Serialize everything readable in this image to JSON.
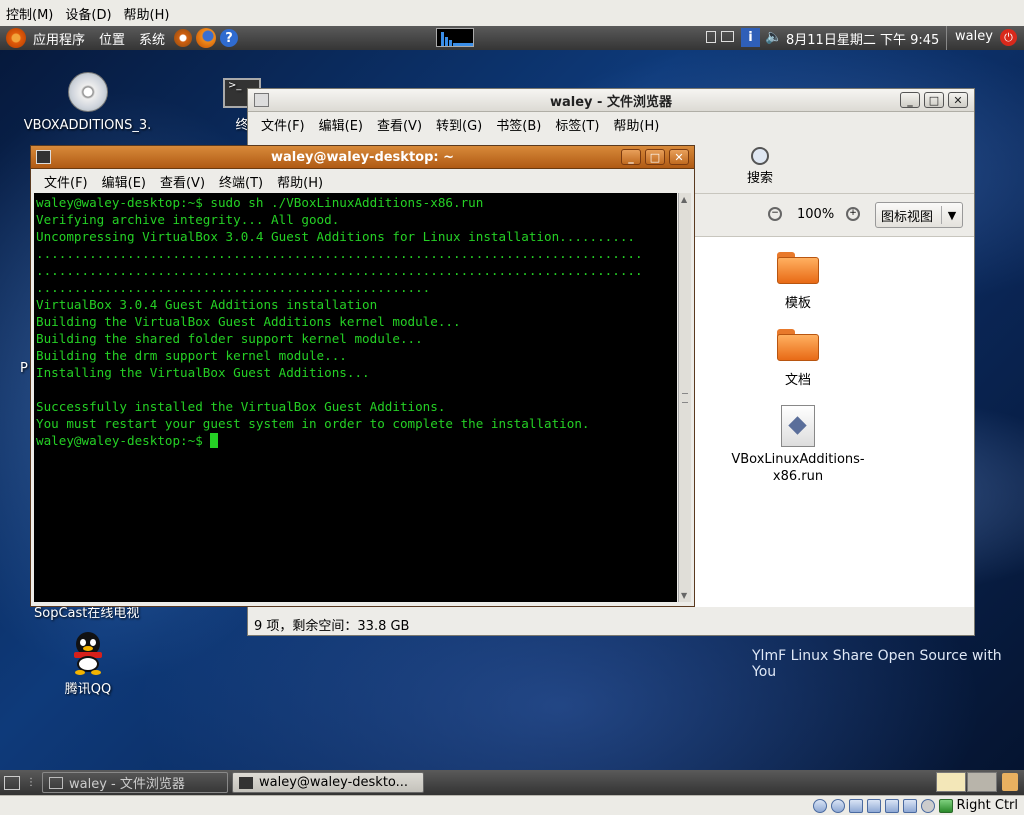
{
  "host": {
    "menu": [
      "控制(M)",
      "设备(D)",
      "帮助(H)"
    ],
    "status": {
      "hostkey": "Right Ctrl"
    }
  },
  "panel": {
    "menus": [
      "应用程序",
      "位置",
      "系统"
    ],
    "datetime": "8月11日星期二 下午 9:45",
    "user": "waley"
  },
  "desktop": {
    "icons": {
      "cd": "VBOXADDITIONS_3.",
      "terminal_partial": "终",
      "sopcast_partial": "SopCast在线电视",
      "qq": "腾讯QQ",
      "left_partial": "P"
    },
    "watermark": "YlmF Linux Share Open Source with You"
  },
  "file_browser": {
    "title": "waley - 文件浏览器",
    "menu": [
      "文件(F)",
      "编辑(E)",
      "查看(V)",
      "转到(G)",
      "书签(B)",
      "标签(T)",
      "帮助(H)"
    ],
    "search_label": "搜索",
    "zoom": "100%",
    "view_mode": "图标视图",
    "files": [
      {
        "name": "模板",
        "type": "folder"
      },
      {
        "name": "文档",
        "type": "folder"
      },
      {
        "name": "VBoxLinuxAdditions-\nx86.run",
        "type": "file"
      }
    ],
    "status": "9 项，剩余空间：33.8 GB"
  },
  "terminal": {
    "title": "waley@waley-desktop: ~",
    "menu": [
      "文件(F)",
      "编辑(E)",
      "查看(V)",
      "终端(T)",
      "帮助(H)"
    ],
    "lines": [
      "waley@waley-desktop:~$ sudo sh ./VBoxLinuxAdditions-x86.run",
      "Verifying archive integrity... All good.",
      "Uncompressing VirtualBox 3.0.4 Guest Additions for Linux installation..........",
      "................................................................................",
      "................................................................................",
      "....................................................",
      "VirtualBox 3.0.4 Guest Additions installation",
      "Building the VirtualBox Guest Additions kernel module...",
      "Building the shared folder support kernel module...",
      "Building the drm support kernel module...",
      "Installing the VirtualBox Guest Additions...",
      "",
      "Successfully installed the VirtualBox Guest Additions.",
      "You must restart your guest system in order to complete the installation."
    ],
    "prompt": "waley@waley-desktop:~$ "
  },
  "taskbar": {
    "items": [
      "waley - 文件浏览器",
      "waley@waley-deskto..."
    ]
  }
}
